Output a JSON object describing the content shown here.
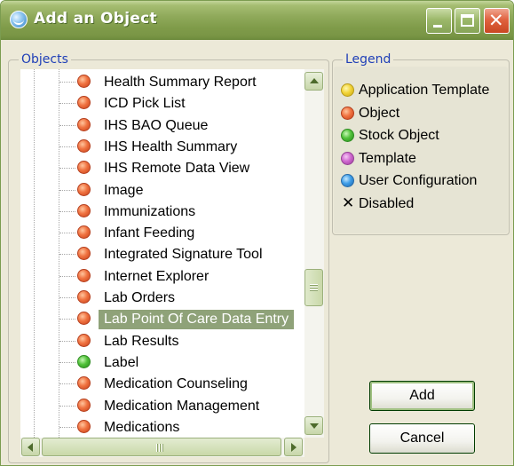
{
  "window": {
    "title": "Add an Object",
    "controls": [
      "minimize",
      "maximize",
      "close"
    ]
  },
  "objects": {
    "label": "Objects",
    "selected_index": 11,
    "items": [
      {
        "label": "Health Summary Report",
        "type": "object"
      },
      {
        "label": "ICD Pick List",
        "type": "object"
      },
      {
        "label": "IHS BAO Queue",
        "type": "object"
      },
      {
        "label": "IHS Health Summary",
        "type": "object"
      },
      {
        "label": "IHS Remote Data View",
        "type": "object"
      },
      {
        "label": "Image",
        "type": "object"
      },
      {
        "label": "Immunizations",
        "type": "object"
      },
      {
        "label": "Infant Feeding",
        "type": "object"
      },
      {
        "label": "Integrated Signature Tool",
        "type": "object"
      },
      {
        "label": "Internet Explorer",
        "type": "object"
      },
      {
        "label": "Lab Orders",
        "type": "object"
      },
      {
        "label": "Lab Point Of Care Data Entry",
        "type": "object"
      },
      {
        "label": "Lab Results",
        "type": "object"
      },
      {
        "label": "Label",
        "type": "stock"
      },
      {
        "label": "Medication Counseling",
        "type": "object"
      },
      {
        "label": "Medication Management",
        "type": "object"
      },
      {
        "label": "Medications",
        "type": "object"
      }
    ]
  },
  "legend": {
    "label": "Legend",
    "items": [
      {
        "label": "Application Template",
        "icon": "yellow-circle-icon",
        "color": "#f2d43a"
      },
      {
        "label": "Object",
        "icon": "orange-circle-icon",
        "color": "#f07341"
      },
      {
        "label": "Stock Object",
        "icon": "green-circle-icon",
        "color": "#52c23b"
      },
      {
        "label": "Template",
        "icon": "magenta-circle-icon",
        "color": "#cf69cf"
      },
      {
        "label": "User Configuration",
        "icon": "blue-circle-icon",
        "color": "#3f9ee8"
      },
      {
        "label": "Disabled",
        "icon": "x-icon",
        "color": "#000000"
      }
    ]
  },
  "buttons": {
    "add": "Add",
    "cancel": "Cancel"
  },
  "colors": {
    "titlebar": "#7f9b49",
    "selection": "#8fa279",
    "group_label": "#1f3fb7",
    "window_bg": "#ece9d8"
  }
}
